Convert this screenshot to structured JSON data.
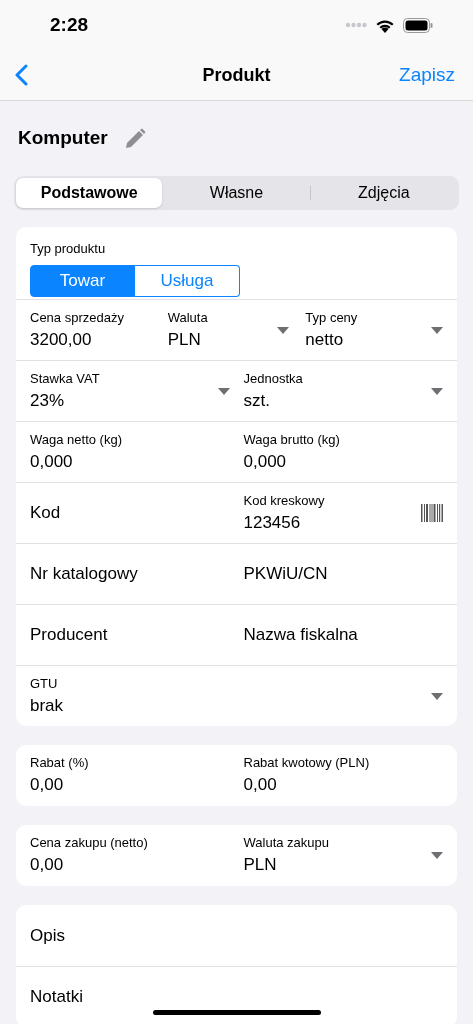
{
  "status_bar": {
    "time": "2:28"
  },
  "nav": {
    "title": "Produkt",
    "action": "Zapisz"
  },
  "product": {
    "name": "Komputer"
  },
  "segments": [
    {
      "label": "Podstawowe",
      "selected": true
    },
    {
      "label": "Własne",
      "selected": false
    },
    {
      "label": "Zdjęcia",
      "selected": false
    }
  ],
  "sections": [
    {
      "rows": [
        {
          "kind": "toggle",
          "label": "Typ produktu",
          "options": [
            {
              "label": "Towar",
              "selected": true
            },
            {
              "label": "Usługa",
              "selected": false
            }
          ]
        },
        {
          "kind": "fields",
          "fields": [
            {
              "kind": "text",
              "label": "Cena sprzedaży",
              "value": "3200,00"
            },
            {
              "kind": "select",
              "label": "Waluta",
              "value": "PLN"
            },
            {
              "kind": "select",
              "label": "Typ ceny",
              "value": "netto"
            }
          ]
        },
        {
          "kind": "fields",
          "fields": [
            {
              "kind": "select",
              "label": "Stawka VAT",
              "value": "23%"
            },
            {
              "kind": "select",
              "label": "Jednostka",
              "value": "szt."
            }
          ]
        },
        {
          "kind": "fields",
          "fields": [
            {
              "kind": "text",
              "label": "Waga netto (kg)",
              "value": "0,000"
            },
            {
              "kind": "text",
              "label": "Waga brutto (kg)",
              "value": "0,000"
            }
          ]
        },
        {
          "kind": "fields",
          "fields": [
            {
              "kind": "text",
              "label": "Kod"
            },
            {
              "kind": "barcode",
              "label": "Kod kreskowy",
              "value": "123456"
            }
          ]
        },
        {
          "kind": "fields",
          "fields": [
            {
              "kind": "text",
              "label": "Nr katalogowy"
            },
            {
              "kind": "text",
              "label": "PKWiU/CN"
            }
          ]
        },
        {
          "kind": "fields",
          "fields": [
            {
              "kind": "text",
              "label": "Producent"
            },
            {
              "kind": "text",
              "label": "Nazwa fiskalna"
            }
          ]
        },
        {
          "kind": "fields",
          "fields": [
            {
              "kind": "select",
              "label": "GTU",
              "value": "brak"
            }
          ]
        }
      ]
    },
    {
      "rows": [
        {
          "kind": "fields",
          "fields": [
            {
              "kind": "text",
              "label": "Rabat (%)",
              "value": "0,00"
            },
            {
              "kind": "text",
              "label": "Rabat kwotowy (PLN)",
              "value": "0,00"
            }
          ]
        }
      ]
    },
    {
      "rows": [
        {
          "kind": "fields",
          "fields": [
            {
              "kind": "text",
              "label": "Cena zakupu (netto)",
              "value": "0,00"
            },
            {
              "kind": "select",
              "label": "Waluta zakupu",
              "value": "PLN"
            }
          ]
        }
      ]
    },
    {
      "rows": [
        {
          "kind": "fields",
          "fields": [
            {
              "kind": "text",
              "label": "Opis"
            }
          ]
        },
        {
          "kind": "fields",
          "fields": [
            {
              "kind": "text",
              "label": "Notatki"
            }
          ]
        }
      ]
    }
  ]
}
